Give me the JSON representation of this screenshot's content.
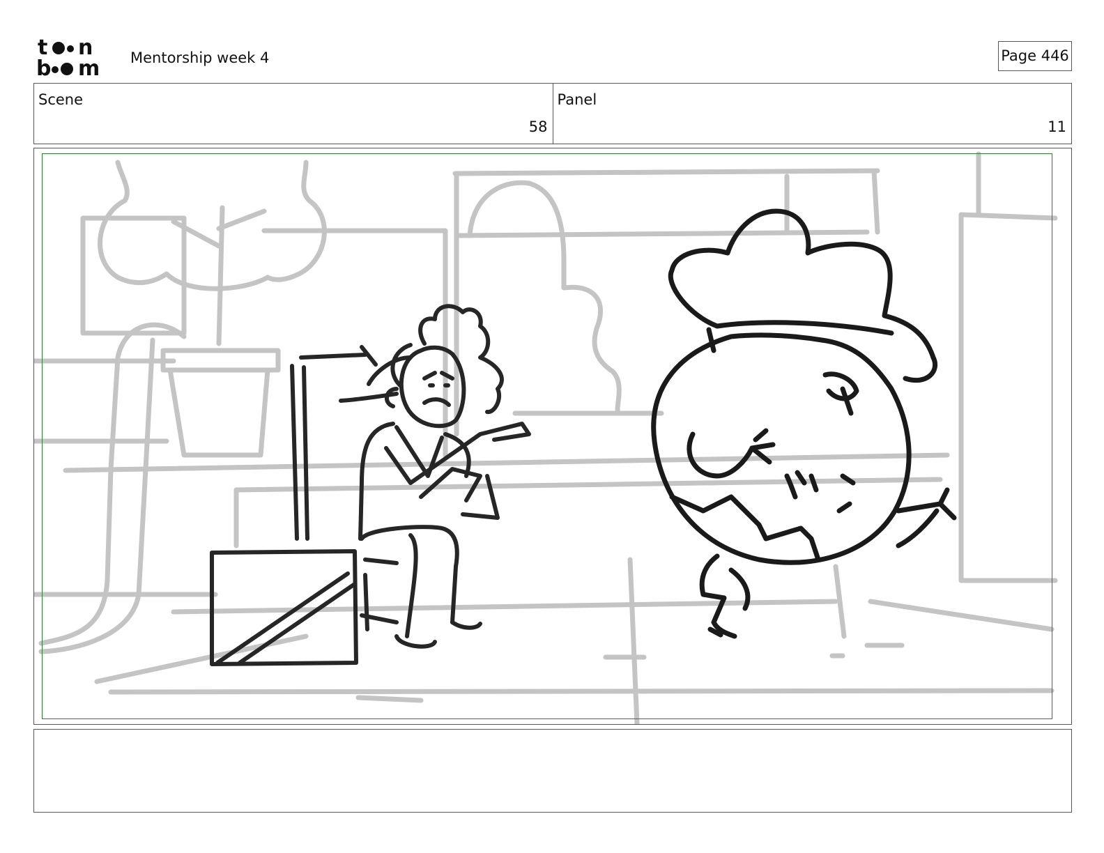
{
  "header": {
    "project_title": "Mentorship week 4",
    "page_label": "Page 446"
  },
  "logo": {
    "text": "toonboom",
    "icon": "toon-boom-logo"
  },
  "scene": {
    "label": "Scene",
    "value": "58"
  },
  "panel": {
    "label": "Panel",
    "value": "11"
  },
  "drawing": {
    "icon": "storyboard-sketch",
    "safe_frame_color": "#2e7d32",
    "sketch_line_color": "#222222",
    "background_line_color": "#bdbdbd"
  },
  "notes": {
    "text": ""
  }
}
